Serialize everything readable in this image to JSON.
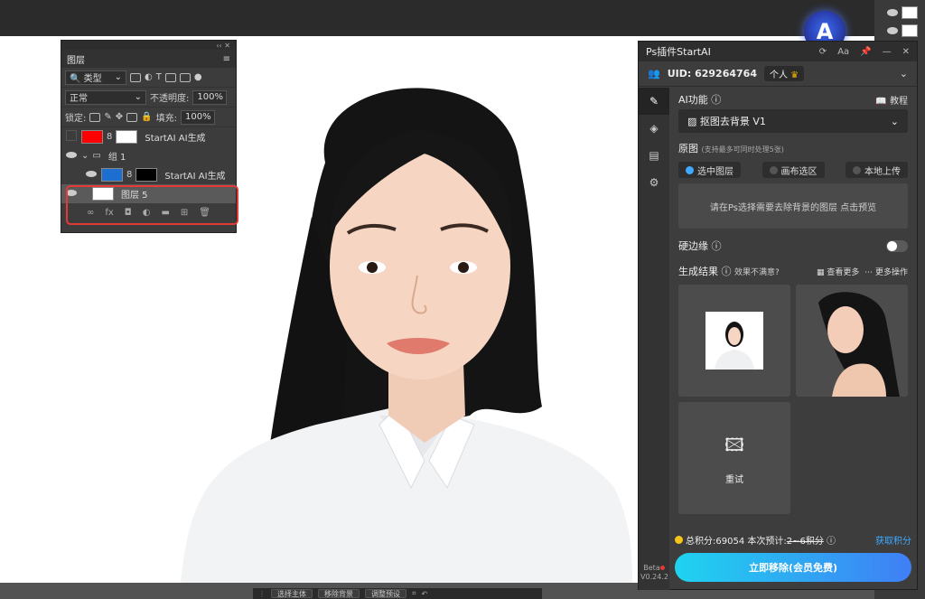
{
  "layers_panel": {
    "tab": "图层",
    "filter_kind": "类型",
    "blend_mode": "正常",
    "opacity_label": "不透明度:",
    "opacity_value": "100%",
    "lock_label": "锁定:",
    "fill_label": "填充:",
    "fill_value": "100%",
    "layers": [
      {
        "name": "StartAI AI生成",
        "visible": false
      },
      {
        "name": "组 1",
        "visible": true
      },
      {
        "name": "StartAI AI生成",
        "visible": true
      },
      {
        "name": "图层 5",
        "visible": true
      }
    ],
    "fx_label": "fx"
  },
  "startai_panel": {
    "title": "Ps插件StartAI",
    "uid": "UID: 629264764",
    "account_type": "个人",
    "ai_function_label": "AI功能",
    "tutorial_label": "教程",
    "function_selected": "抠图去背景 V1",
    "source_label": "原图",
    "source_hint": "(支持最多可同时处理5张)",
    "source_options": [
      "选中图层",
      "画布选区",
      "本地上传"
    ],
    "source_selected_index": 0,
    "preview_hint": "请在Ps选择需要去除背景的图层 点击预览",
    "hard_edge_label": "硬边缘",
    "hard_edge_on": false,
    "results_label": "生成结果",
    "unsatisfied_label": "效果不满意?",
    "view_more_label": "查看更多",
    "more_actions_label": "更多操作",
    "retry_label": "重试",
    "total_credits": "总积分:69054",
    "estimate_label": "本次预计:",
    "estimate_value": "2~6积分",
    "get_credits": "获取积分",
    "cta_label": "立即移除(会员免费)",
    "beta_label": "Beta",
    "version": "V0.24.2"
  },
  "taskbar": {
    "buttons": [
      "选择主体",
      "移除背景",
      "调整预设"
    ]
  },
  "colors": {
    "panel_bg": "#3d3d3d",
    "accent_blue": "#3fa9ff",
    "cta_gradient_start": "#1fd3f0",
    "cta_gradient_end": "#3f7ff5",
    "highlight_red": "#e53935"
  }
}
